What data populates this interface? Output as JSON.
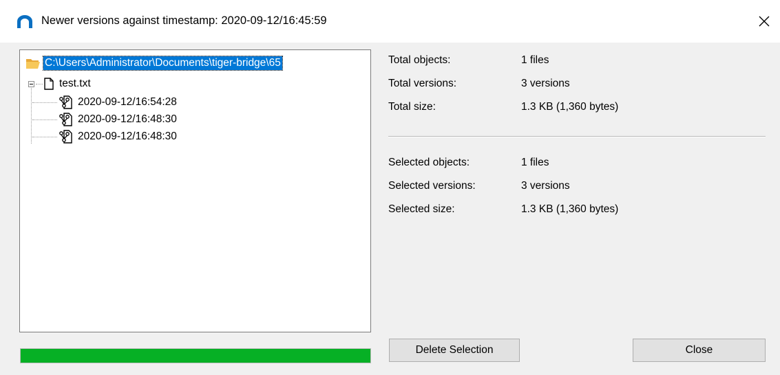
{
  "window": {
    "title": "Newer versions against timestamp: 2020-09-12/16:45:59",
    "app_icon": "tiger-bridge-arch-icon",
    "close_glyph": "✕"
  },
  "tree": {
    "root": {
      "label": "C:\\Users\\Administrator\\Documents\\tiger-bridge\\65",
      "icon": "folder-open-icon",
      "selected": true
    },
    "file": {
      "label": "test.txt",
      "icon": "file-icon",
      "expanded": true
    },
    "versions": [
      {
        "label": "2020-09-12/16:54:28",
        "icon": "version-icon"
      },
      {
        "label": "2020-09-12/16:48:30",
        "icon": "version-icon"
      },
      {
        "label": "2020-09-12/16:48:30",
        "icon": "version-icon"
      }
    ]
  },
  "totals": {
    "objects": {
      "label": "Total objects:",
      "value": "1 files"
    },
    "versions": {
      "label": "Total versions:",
      "value": "3 versions"
    },
    "size": {
      "label": "Total size:",
      "value": "1.3 KB (1,360 bytes)"
    }
  },
  "selected": {
    "objects": {
      "label": "Selected objects:",
      "value": "1 files"
    },
    "versions": {
      "label": "Selected versions:",
      "value": "3 versions"
    },
    "size": {
      "label": "Selected size:",
      "value": "1.3 KB (1,360 bytes)"
    }
  },
  "progress": {
    "fraction": 1.0,
    "color": "#06b025"
  },
  "buttons": {
    "delete": "Delete Selection",
    "close": "Close"
  },
  "colors": {
    "selection": "#0078d7",
    "app_icon": "#0a6fc2"
  }
}
